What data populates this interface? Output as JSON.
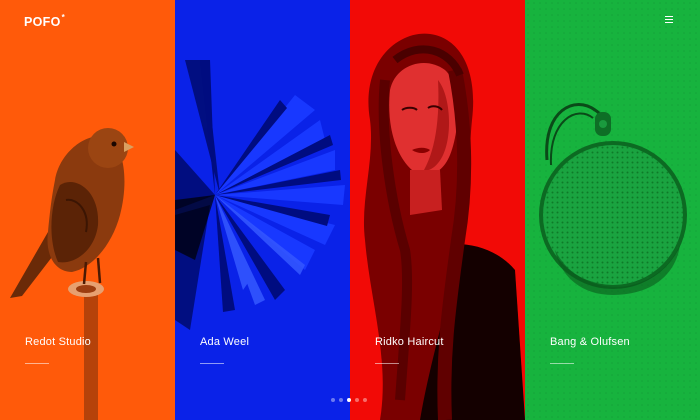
{
  "header": {
    "logo_text": "POFO",
    "logo_mark": "*"
  },
  "menu": {
    "icon": "hamburger-menu-icon"
  },
  "panels": [
    {
      "title": "Redot Studio",
      "color": "#ff5a0a",
      "image": "bird-on-perch"
    },
    {
      "title": "Ada Weel",
      "color": "#0a22e8",
      "image": "fanned-paper-burst"
    },
    {
      "title": "Ridko Haircut",
      "color": "#f20a06",
      "image": "woman-portrait"
    },
    {
      "title": "Bang & Olufsen",
      "color": "#17b33e",
      "image": "round-speaker"
    }
  ],
  "pagination": {
    "count": 5,
    "active_index": 2
  }
}
